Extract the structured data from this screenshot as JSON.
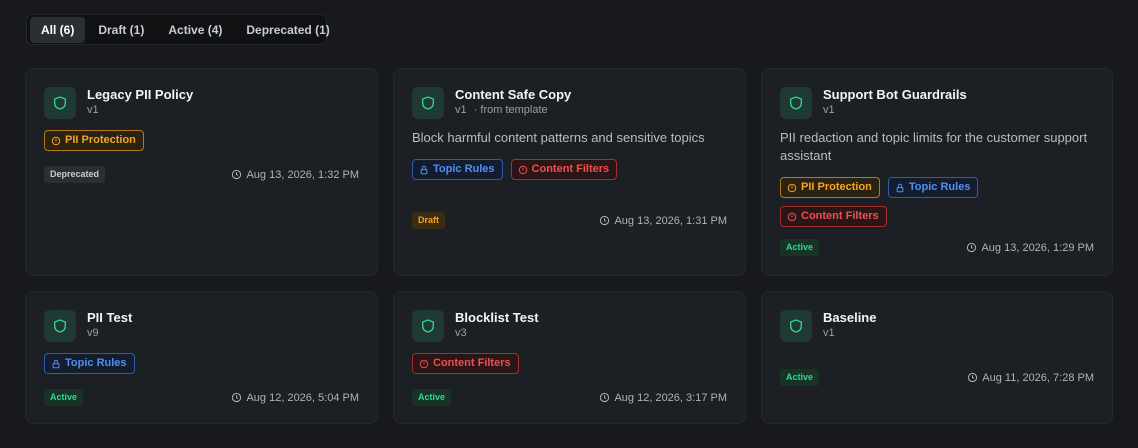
{
  "tabs": [
    {
      "label": "All (6)",
      "active": true
    },
    {
      "label": "Draft (1)",
      "active": false
    },
    {
      "label": "Active (4)",
      "active": false
    },
    {
      "label": "Deprecated (1)",
      "active": false
    }
  ],
  "colors": {
    "accent_green": "#34d399",
    "pii": "#f5a524",
    "topic": "#4f8ef7",
    "content": "#f04f4f"
  },
  "cards": [
    {
      "title": "Legacy PII Policy",
      "version": "v1",
      "source": "",
      "description": "",
      "tags": [
        {
          "kind": "pii",
          "icon": "shield-alert-icon",
          "label": "PII Protection"
        }
      ],
      "status": "Deprecated",
      "date": "Aug 13, 2026, 1:32 PM"
    },
    {
      "title": "Content Safe Copy",
      "version": "v1",
      "source": "· from template",
      "description": "Block harmful content patterns and sensitive topics",
      "tags": [
        {
          "kind": "topic",
          "icon": "lock-icon",
          "label": "Topic Rules"
        },
        {
          "kind": "content",
          "icon": "shield-alert-icon",
          "label": "Content Filters"
        }
      ],
      "status": "Draft",
      "date": "Aug 13, 2026, 1:31 PM"
    },
    {
      "title": "Support Bot Guardrails",
      "version": "v1",
      "source": "",
      "description": "PII redaction and topic limits for the customer support assistant",
      "tags": [
        {
          "kind": "pii",
          "icon": "shield-alert-icon",
          "label": "PII Protection"
        },
        {
          "kind": "topic",
          "icon": "lock-icon",
          "label": "Topic Rules"
        },
        {
          "kind": "content",
          "icon": "shield-alert-icon",
          "label": "Content Filters"
        }
      ],
      "status": "Active",
      "date": "Aug 13, 2026, 1:29 PM"
    },
    {
      "title": "PII Test",
      "version": "v9",
      "source": "",
      "description": "",
      "tags": [
        {
          "kind": "topic",
          "icon": "lock-icon",
          "label": "Topic Rules"
        }
      ],
      "status": "Active",
      "date": "Aug 12, 2026, 5:04 PM"
    },
    {
      "title": "Blocklist Test",
      "version": "v3",
      "source": "",
      "description": "",
      "tags": [
        {
          "kind": "content",
          "icon": "shield-alert-icon",
          "label": "Content Filters"
        }
      ],
      "status": "Active",
      "date": "Aug 12, 2026, 3:17 PM"
    },
    {
      "title": "Baseline",
      "version": "v1",
      "source": "",
      "description": "",
      "tags": [],
      "status": "Active",
      "date": "Aug 11, 2026, 7:28 PM"
    }
  ]
}
